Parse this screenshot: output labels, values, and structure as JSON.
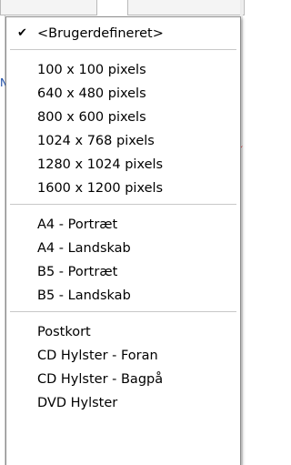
{
  "menu": {
    "groups": [
      {
        "items": [
          {
            "label": "<Brugerdefineret>",
            "checked": true
          }
        ]
      },
      {
        "items": [
          {
            "label": "100 x 100 pixels"
          },
          {
            "label": "640 x 480 pixels"
          },
          {
            "label": "800 x 600 pixels"
          },
          {
            "label": "1024 x 768 pixels"
          },
          {
            "label": "1280 x 1024 pixels"
          },
          {
            "label": "1600 x 1200 pixels"
          }
        ]
      },
      {
        "items": [
          {
            "label": "A4 - Portræt"
          },
          {
            "label": "A4 - Landskab"
          },
          {
            "label": "B5 - Portræt"
          },
          {
            "label": "B5 - Landskab"
          }
        ]
      },
      {
        "items": [
          {
            "label": "Postkort"
          },
          {
            "label": "CD Hylster - Foran"
          },
          {
            "label": "CD Hylster - Bagpå"
          },
          {
            "label": "DVD Hylster"
          }
        ]
      }
    ]
  },
  "background": {
    "partial_letter": "N",
    "arrow_color": "#e21b22"
  }
}
